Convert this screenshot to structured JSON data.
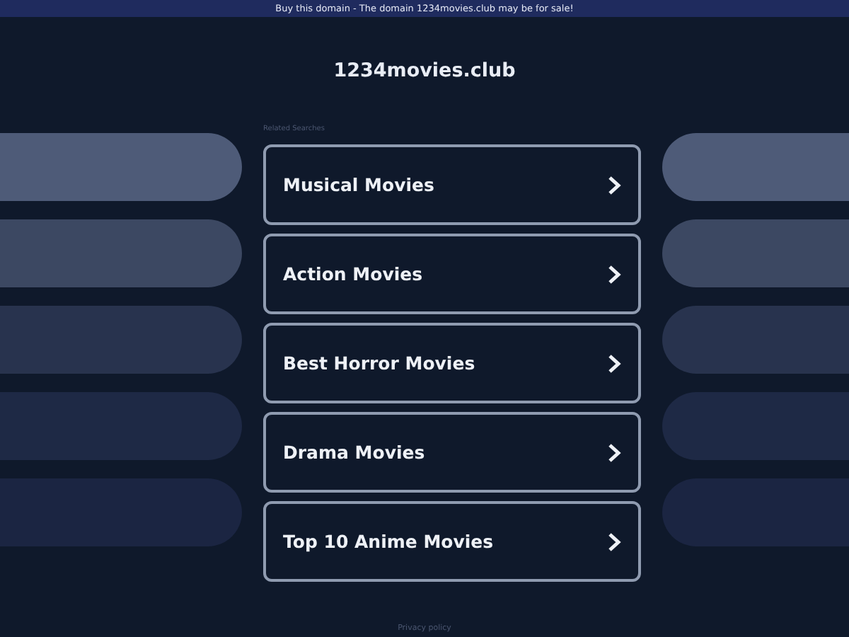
{
  "banner": {
    "text": "Buy this domain - The domain 1234movies.club may be for sale!"
  },
  "site_title": "1234movies.club",
  "related_label": "Related Searches",
  "links": [
    {
      "label": "Musical Movies"
    },
    {
      "label": "Action Movies"
    },
    {
      "label": "Best Horror Movies"
    },
    {
      "label": "Drama Movies"
    },
    {
      "label": "Top 10 Anime Movies"
    }
  ],
  "footer": {
    "privacy": "Privacy policy"
  }
}
